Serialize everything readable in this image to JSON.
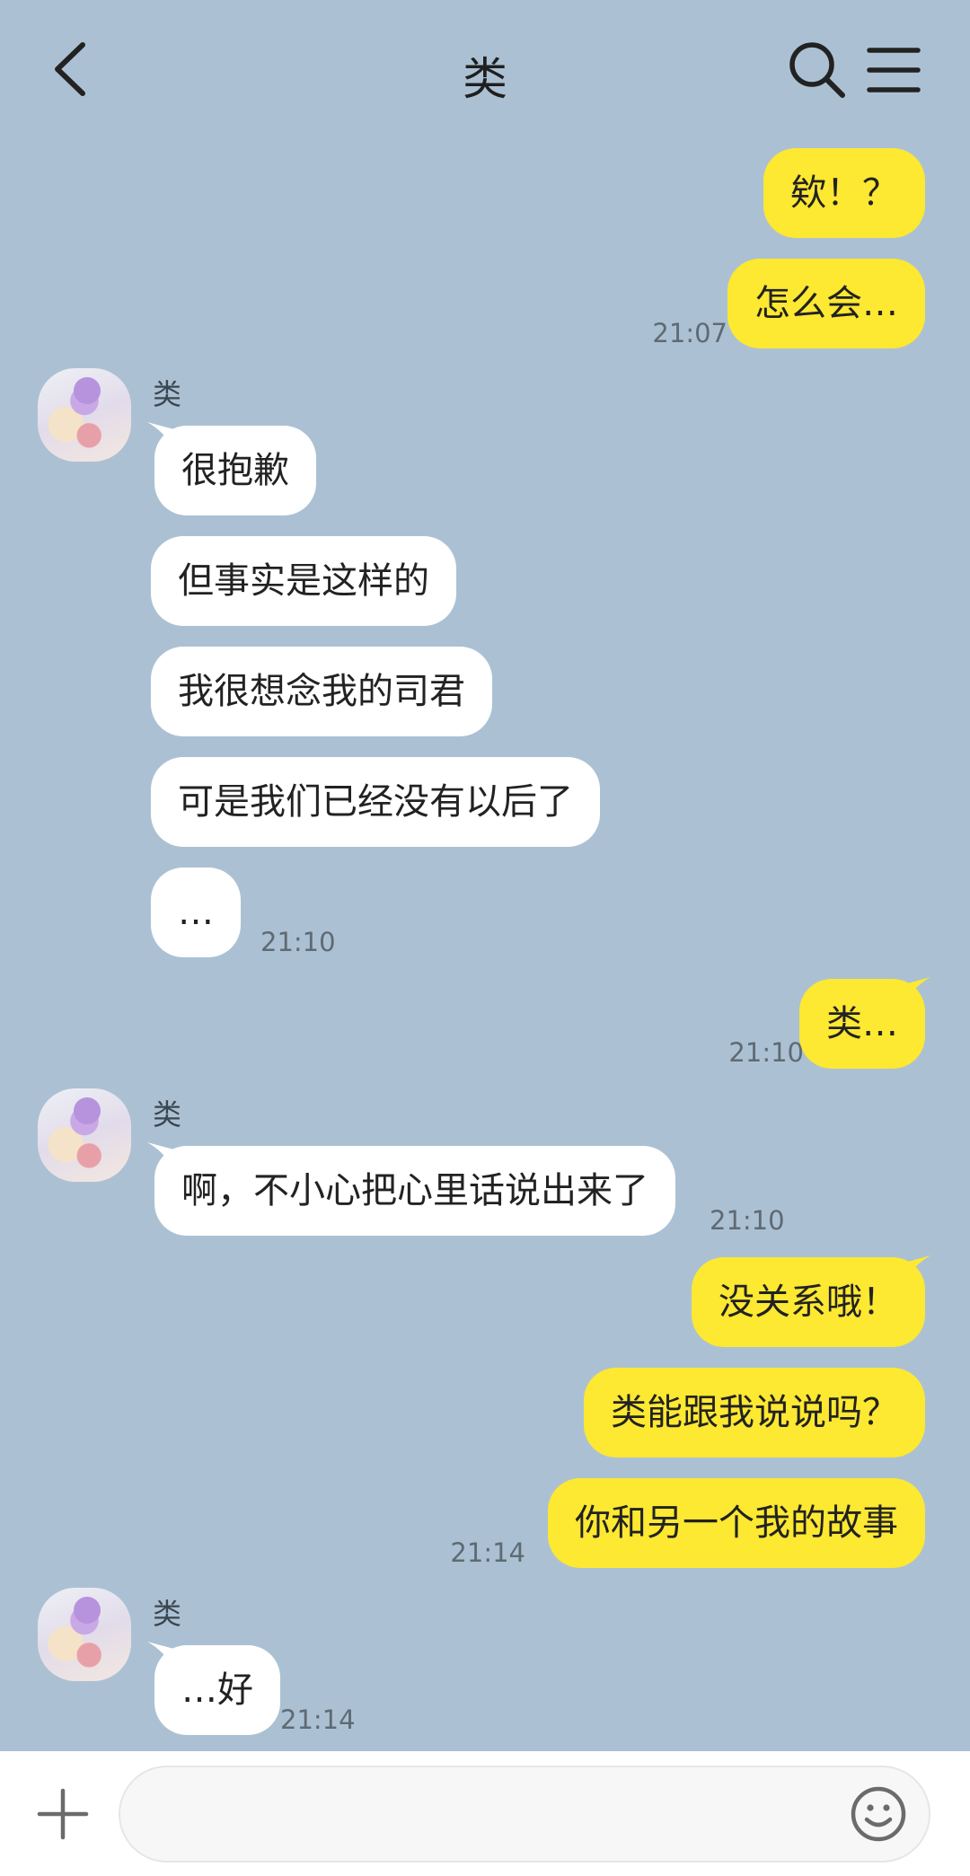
{
  "header": {
    "title": "类",
    "back_icon": "chevron-left-icon",
    "search_icon": "search-icon",
    "menu_icon": "hamburger-menu-icon"
  },
  "colors": {
    "background": "#abc1d3",
    "incoming_bubble": "#ffffff",
    "outgoing_bubble": "#fde832",
    "timestamp": "#5f6a74"
  },
  "messages": [
    {
      "from": "me",
      "text": "欸！？"
    },
    {
      "from": "me",
      "text": "怎么会…",
      "time": "21:07"
    },
    {
      "from": "类",
      "sender": "类",
      "text": "很抱歉"
    },
    {
      "from": "类",
      "text": "但事实是这样的"
    },
    {
      "from": "类",
      "text": "我很想念我的司君"
    },
    {
      "from": "类",
      "text": "可是我们已经没有以后了"
    },
    {
      "from": "类",
      "text": "…",
      "time": "21:10"
    },
    {
      "from": "me",
      "text": "类…",
      "time": "21:10"
    },
    {
      "from": "类",
      "sender": "类",
      "text": "啊，不小心把心里话说出来了",
      "time": "21:10"
    },
    {
      "from": "me",
      "text": "没关系哦！"
    },
    {
      "from": "me",
      "text": "类能跟我说说吗？"
    },
    {
      "from": "me",
      "text": "你和另一个我的故事",
      "time": "21:14"
    },
    {
      "from": "类",
      "sender": "类",
      "text": "…好",
      "time": "21:14"
    }
  ],
  "composer": {
    "plus_icon": "plus-icon",
    "input_value": "",
    "emoji_icon": "smiley-face-icon"
  }
}
